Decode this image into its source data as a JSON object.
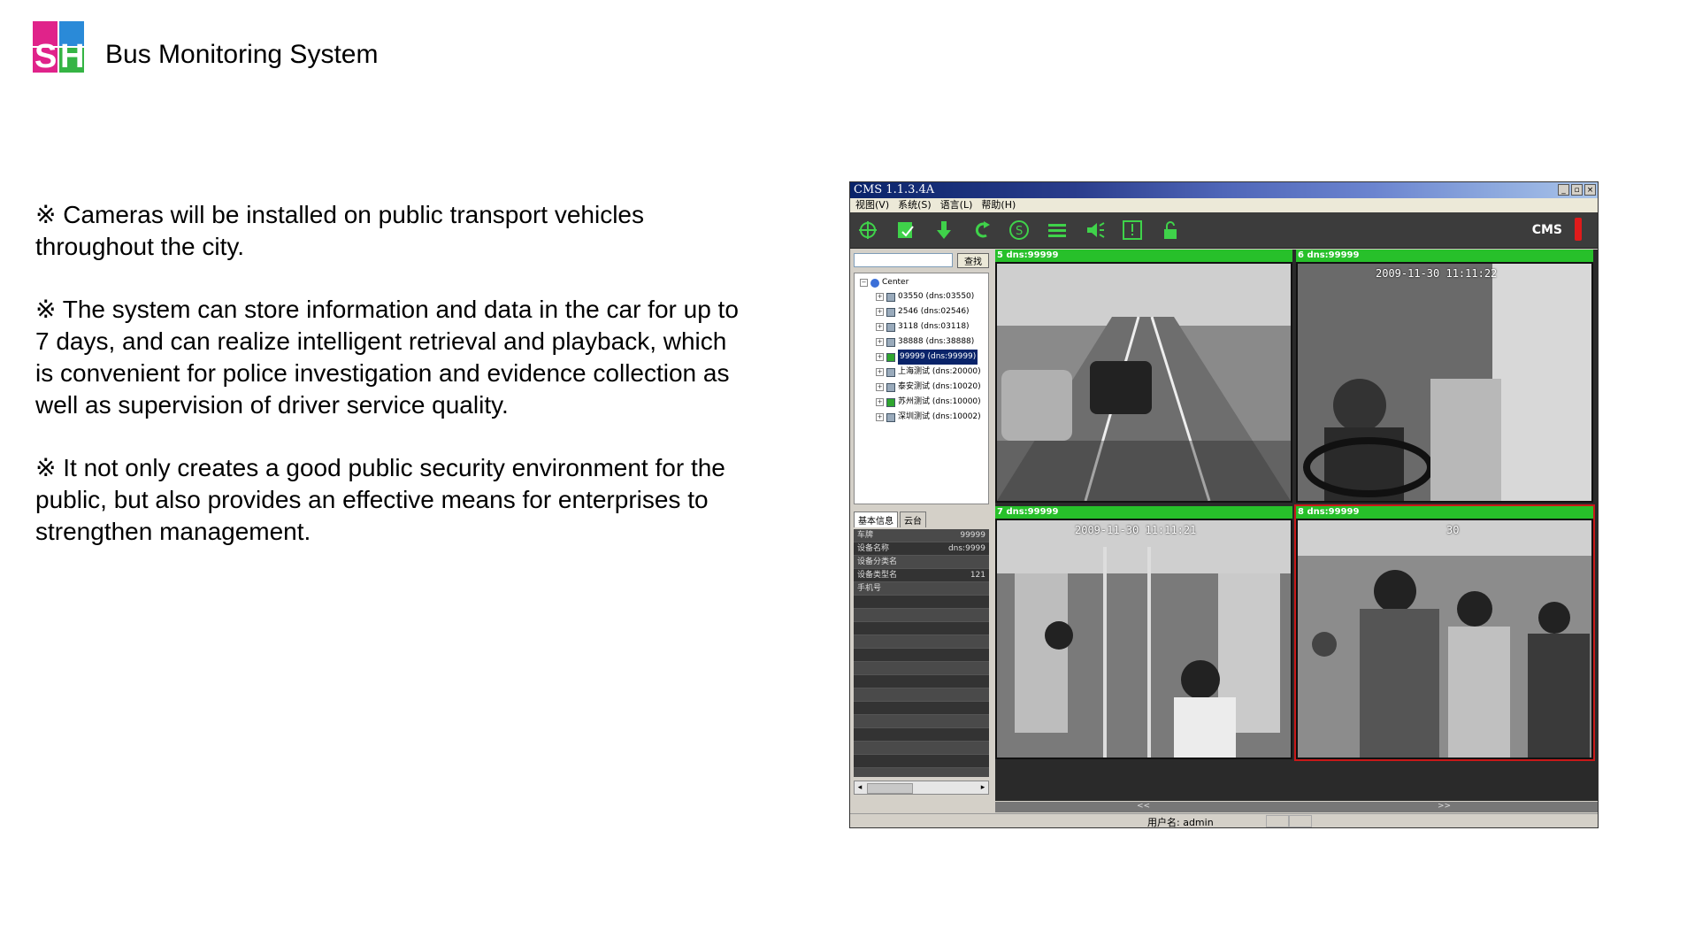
{
  "header": {
    "title": "Bus Monitoring System",
    "logo_text": "SH"
  },
  "content": {
    "paragraphs": [
      "※ Cameras will be installed on public transport vehicles throughout the city.",
      "※ The system can store information and data in the car for up to 7 days, and can realize intelligent retrieval and playback, which is convenient for police investigation and evidence collection as well as supervision of driver service quality.",
      "※ It not only creates a good public security environment for the public, but also provides an effective means for enterprises to strengthen management."
    ]
  },
  "cms": {
    "title": "CMS 1.1.3.4A",
    "window_buttons": [
      "_",
      "▫",
      "×"
    ],
    "menu": [
      "视图(V)",
      "系统(S)",
      "语言(L)",
      "帮助(H)"
    ],
    "toolbar_icons": [
      "crosshair-icon",
      "checklist-icon",
      "download-icon",
      "undo-icon",
      "record-icon",
      "layers-icon",
      "speaker-icon",
      "alert-icon",
      "lock-icon"
    ],
    "brand": "CMS",
    "search": {
      "button": "查找",
      "value": ""
    },
    "tree": {
      "root": "Center",
      "items": [
        {
          "label": "03550 (dns:03550)",
          "online": false,
          "selected": false
        },
        {
          "label": "2546 (dns:02546)",
          "online": false,
          "selected": false
        },
        {
          "label": "3118 (dns:03118)",
          "online": false,
          "selected": false
        },
        {
          "label": "38888 (dns:38888)",
          "online": false,
          "selected": false
        },
        {
          "label": "99999 (dns:99999)",
          "online": true,
          "selected": true
        },
        {
          "label": "上海测试 (dns:20000)",
          "online": false,
          "selected": false
        },
        {
          "label": "泰安测试 (dns:10020)",
          "online": false,
          "selected": false
        },
        {
          "label": "苏州测试 (dns:10000)",
          "online": true,
          "selected": false
        },
        {
          "label": "深圳测试 (dns:10002)",
          "online": false,
          "selected": false
        }
      ]
    },
    "tabs": [
      "基本信息",
      "云台"
    ],
    "info_rows": [
      {
        "label": "车牌",
        "value": "99999"
      },
      {
        "label": "设备名称",
        "value": "dns:9999"
      },
      {
        "label": "设备分类名",
        "value": ""
      },
      {
        "label": "设备类型名",
        "value": "121"
      },
      {
        "label": "手机号",
        "value": ""
      }
    ],
    "cameras": [
      {
        "label": "5 dns:99999",
        "timestamp": "",
        "selected": false
      },
      {
        "label": "6 dns:99999",
        "timestamp": "2009-11-30 11:11:22",
        "selected": false
      },
      {
        "label": "7 dns:99999",
        "timestamp": "2009-11-30  11:11:21",
        "selected": false
      },
      {
        "label": "8 dns:99999",
        "timestamp": "30",
        "selected": true
      }
    ],
    "nav": {
      "prev": "<<",
      "next": ">>"
    },
    "status": {
      "user": "用户名: admin"
    }
  }
}
